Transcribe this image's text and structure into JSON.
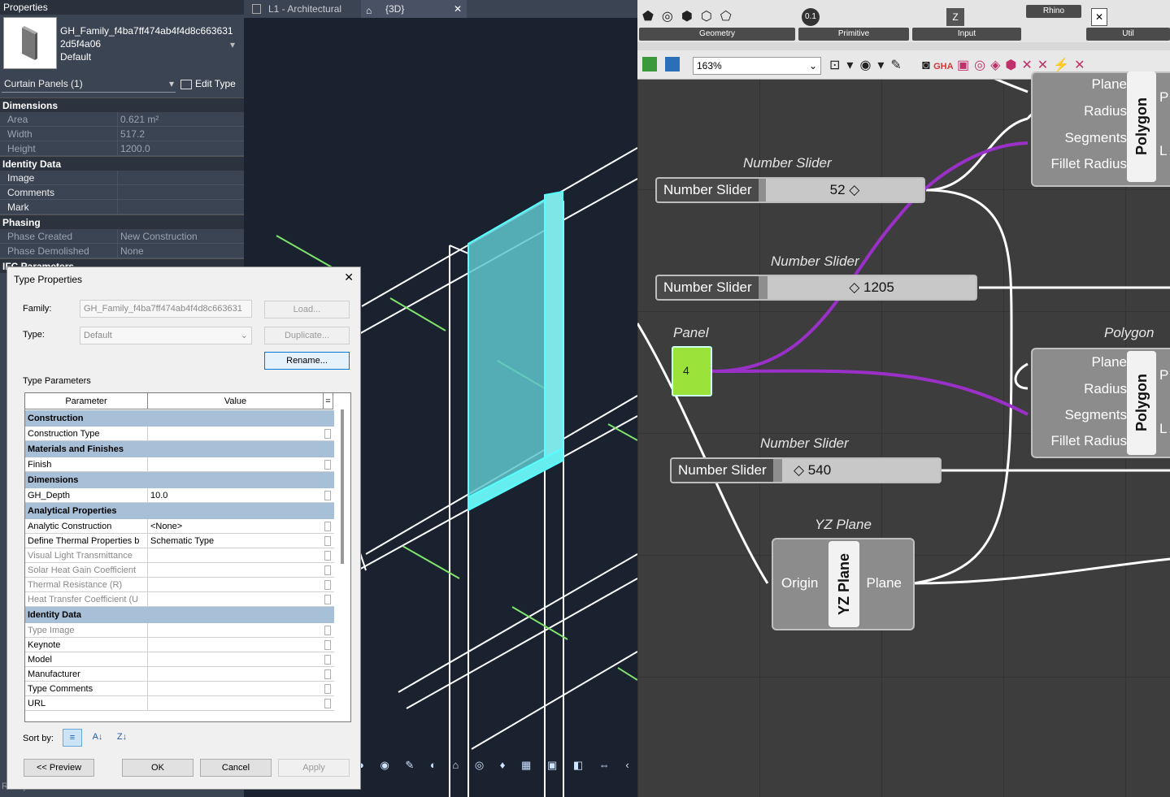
{
  "properties": {
    "title": "Properties",
    "family_name_line1": "GH_Family_f4ba7ff474ab4f4d8c663631",
    "family_name_line2": "2d5f4a06",
    "family_type": "Default",
    "selection": "Curtain Panels (1)",
    "edit_type": "Edit Type",
    "groups": [
      {
        "name": "Dimensions",
        "rows": [
          {
            "k": "Area",
            "v": "0.621 m²",
            "grey": true
          },
          {
            "k": "Width",
            "v": "517.2",
            "grey": true
          },
          {
            "k": "Height",
            "v": "1200.0",
            "grey": true
          }
        ]
      },
      {
        "name": "Identity Data",
        "rows": [
          {
            "k": "Image",
            "v": ""
          },
          {
            "k": "Comments",
            "v": ""
          },
          {
            "k": "Mark",
            "v": ""
          }
        ]
      },
      {
        "name": "Phasing",
        "rows": [
          {
            "k": "Phase Created",
            "v": "New Construction",
            "grey": true
          },
          {
            "k": "Phase Demolished",
            "v": "None",
            "grey": true
          }
        ]
      }
    ],
    "ifc_group": "IFC Parameters"
  },
  "tabs": {
    "tab1": "L1 - Architectural",
    "tab2": "{3D}"
  },
  "dialog": {
    "title": "Type Properties",
    "family_label": "Family:",
    "family_value": "GH_Family_f4ba7ff474ab4f4d8c663631",
    "load": "Load...",
    "type_label": "Type:",
    "type_value": "Default",
    "duplicate": "Duplicate...",
    "rename": "Rename...",
    "type_params": "Type Parameters",
    "col_param": "Parameter",
    "col_value": "Value",
    "sort_by": "Sort by:",
    "preview": "<< Preview",
    "ok": "OK",
    "cancel": "Cancel",
    "apply": "Apply",
    "table": [
      {
        "g": "Construction"
      },
      {
        "p": "Construction Type",
        "v": ""
      },
      {
        "g": "Materials and Finishes"
      },
      {
        "p": "Finish",
        "v": ""
      },
      {
        "g": "Dimensions"
      },
      {
        "p": "GH_Depth",
        "v": "10.0"
      },
      {
        "g": "Analytical Properties"
      },
      {
        "p": "Analytic Construction",
        "v": "<None>"
      },
      {
        "p": "Define Thermal Properties b",
        "v": "Schematic Type"
      },
      {
        "p": "Visual Light Transmittance",
        "v": "",
        "grey": true
      },
      {
        "p": "Solar Heat Gain Coefficient",
        "v": "",
        "grey": true
      },
      {
        "p": "Thermal Resistance (R)",
        "v": "",
        "grey": true
      },
      {
        "p": "Heat Transfer Coefficient (U",
        "v": "",
        "grey": true
      },
      {
        "g": "Identity Data"
      },
      {
        "p": "Type Image",
        "v": "",
        "grey": true
      },
      {
        "p": "Keynote",
        "v": ""
      },
      {
        "p": "Model",
        "v": ""
      },
      {
        "p": "Manufacturer",
        "v": ""
      },
      {
        "p": "Type Comments",
        "v": ""
      },
      {
        "p": "URL",
        "v": ""
      }
    ]
  },
  "status": "Ready",
  "gh": {
    "ribbon_groups": [
      "Geometry",
      "Primitive",
      "Input",
      "Rhino",
      "Util"
    ],
    "zoom": "163%",
    "toolbar_label": "GHA",
    "slider1": {
      "nick": "Number Slider",
      "label": "Number Slider",
      "value": "52"
    },
    "slider2": {
      "nick": "Number Slider",
      "label": "Number Slider",
      "value": "1205"
    },
    "slider3": {
      "nick": "Number Slider",
      "label": "Number Slider",
      "value": "540"
    },
    "panel": {
      "nick": "Panel",
      "value": "4"
    },
    "polygon1": {
      "inputs": [
        "Plane",
        "Radius",
        "Segments",
        "Fillet Radius"
      ],
      "label": "Polygon",
      "out1": "P",
      "out2": "L"
    },
    "polygon2": {
      "nick": "Polygon",
      "inputs": [
        "Plane",
        "Radius",
        "Segments",
        "Fillet Radius"
      ],
      "label": "Polygon",
      "out1": "P",
      "out2": "L"
    },
    "yzplane": {
      "nick": "YZ Plane",
      "input": "Origin",
      "label": "YZ Plane",
      "output": "Plane"
    }
  }
}
